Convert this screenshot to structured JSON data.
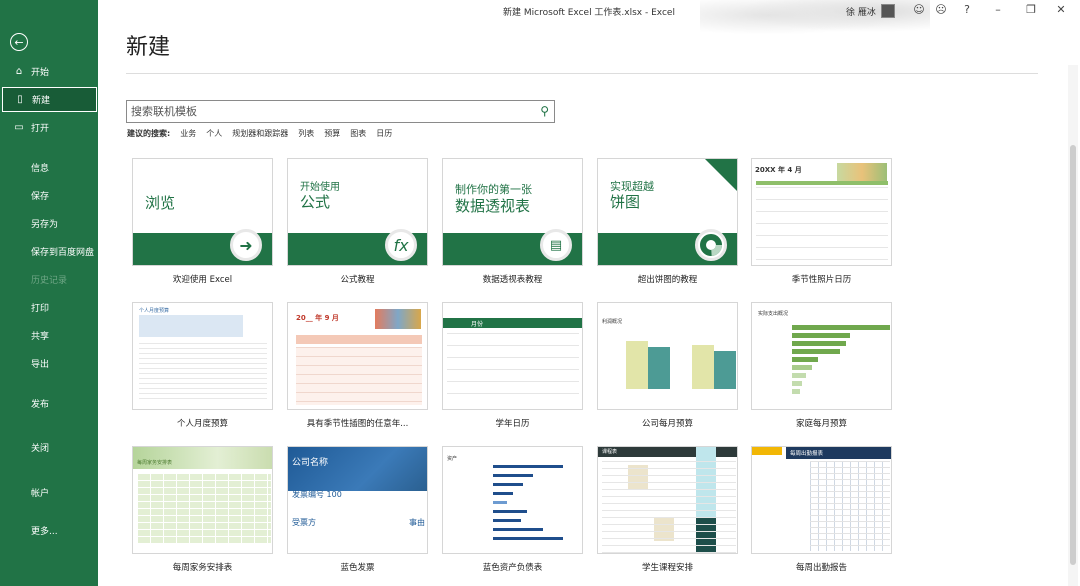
{
  "window": {
    "title": "新建 Microsoft Excel 工作表.xlsx  -  Excel",
    "user": "徐 雁冰"
  },
  "sidebar": {
    "items": [
      {
        "label": "开始",
        "icon": "home-icon"
      },
      {
        "label": "新建",
        "icon": "new-file-icon"
      },
      {
        "label": "打开",
        "icon": "folder-open-icon"
      },
      {
        "label": "信息"
      },
      {
        "label": "保存"
      },
      {
        "label": "另存为"
      },
      {
        "label": "保存到百度网盘"
      },
      {
        "label": "历史记录"
      },
      {
        "label": "打印"
      },
      {
        "label": "共享"
      },
      {
        "label": "导出"
      },
      {
        "label": "发布"
      },
      {
        "label": "关闭"
      },
      {
        "label": "帐户"
      },
      {
        "label": "更多..."
      }
    ]
  },
  "main": {
    "heading": "新建",
    "search_placeholder": "搜索联机模板",
    "suggested_label": "建议的搜索:",
    "suggestions": [
      "业务",
      "个人",
      "规划器和跟踪器",
      "列表",
      "预算",
      "图表",
      "日历"
    ]
  },
  "templates": [
    {
      "label": "欢迎使用 Excel",
      "title": "浏览"
    },
    {
      "label": "公式教程",
      "title1": "开始使用",
      "title2": "公式"
    },
    {
      "label": "数据透视表教程",
      "title1": "制作你的第一张",
      "title2": "数据透视表"
    },
    {
      "label": "超出饼图的教程",
      "title1": "实现超越",
      "title2": "饼图"
    },
    {
      "label": "季节性照片日历",
      "title": "20XX 年 4 月"
    },
    {
      "label": "个人月度预算",
      "title": "个人月度预算"
    },
    {
      "label": "具有季节性插图的任意年...",
      "title": "20__ 年 9 月"
    },
    {
      "label": "学年日历",
      "title": "月份"
    },
    {
      "label": "公司每月预算",
      "title": "利润概况"
    },
    {
      "label": "家庭每月预算",
      "title": "实际支出概况"
    },
    {
      "label": "每周家务安排表",
      "title": "每周家务安排表"
    },
    {
      "label": "蓝色发票",
      "title": "公司名称",
      "subtitle": "发票编号 100",
      "payee": "受票方",
      "sub": "事由"
    },
    {
      "label": "蓝色资产负债表",
      "title": "资产"
    },
    {
      "label": "学生课程安排",
      "title": "课程表"
    },
    {
      "label": "每周出勤报告",
      "title": "每周出勤报表"
    }
  ],
  "colors": {
    "accent": "#217346",
    "accent_dark": "#185c37"
  }
}
